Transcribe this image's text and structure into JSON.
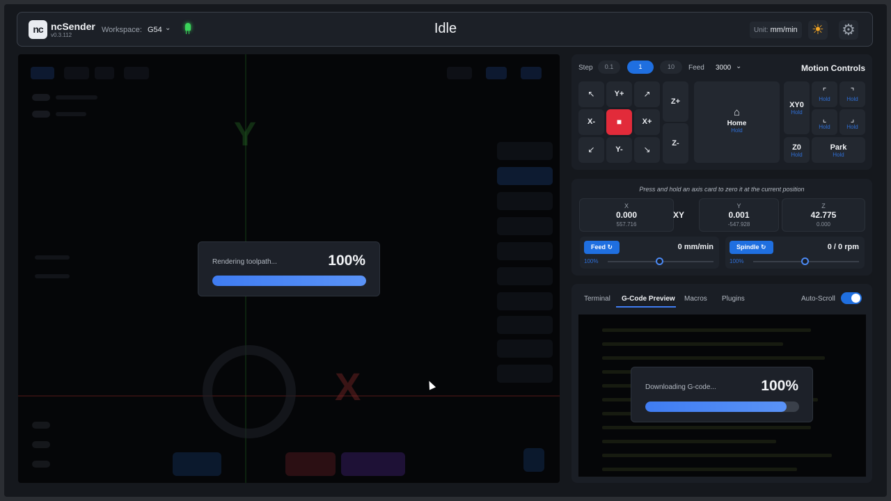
{
  "header": {
    "logo": "nc",
    "app_name": "ncSender",
    "version": "v0.3.112",
    "workspace_label": "Workspace:",
    "workspace_value": "G54",
    "status": "Idle",
    "unit_label": "Unit:",
    "unit_value": "mm/min"
  },
  "viz_modal": {
    "label": "Rendering toolpath...",
    "percent": "100%",
    "progress": 1.0
  },
  "motion": {
    "step_label": "Step",
    "steps": [
      "0.1",
      "1",
      "10"
    ],
    "active_step": "1",
    "feed_label": "Feed",
    "feed_value": "3000",
    "title": "Motion Controls",
    "jog": {
      "y_plus": "Y+",
      "y_minus": "Y-",
      "x_plus": "X+",
      "x_minus": "X-",
      "z_plus": "Z+",
      "z_minus": "Z-",
      "nw": "↖",
      "ne": "↗",
      "sw": "↙",
      "se": "↘",
      "stop": "■"
    },
    "home_label": "Home",
    "hold_label": "Hold",
    "xy0_label": "XY0",
    "z0_label": "Z0",
    "park_label": "Park"
  },
  "position": {
    "hint": "Press and hold an axis card to zero it at the current position",
    "x": {
      "name": "X",
      "value": "0.000",
      "machine": "557.716"
    },
    "xy_label": "XY",
    "y": {
      "name": "Y",
      "value": "0.001",
      "machine": "-547.928"
    },
    "z": {
      "name": "Z",
      "value": "42.775",
      "machine": "0.000"
    },
    "feed": {
      "label": "Feed ↻",
      "value": "0 mm/min",
      "percent": "100%"
    },
    "spindle": {
      "label": "Spindle ↻",
      "value": "0 / 0 rpm",
      "percent": "100%"
    }
  },
  "terminal": {
    "tabs": [
      "Terminal",
      "G-Code Preview",
      "Macros",
      "Plugins"
    ],
    "active_tab": "G-Code Preview",
    "autoscroll_label": "Auto-Scroll",
    "autoscroll_on": true
  },
  "gcode_modal": {
    "label": "Downloading G-code...",
    "percent": "100%",
    "progress": 0.92
  },
  "colors": {
    "accent": "#1f6fe0",
    "stop": "#e22b3a",
    "led": "#3ad45a",
    "sun": "#f5a623"
  }
}
